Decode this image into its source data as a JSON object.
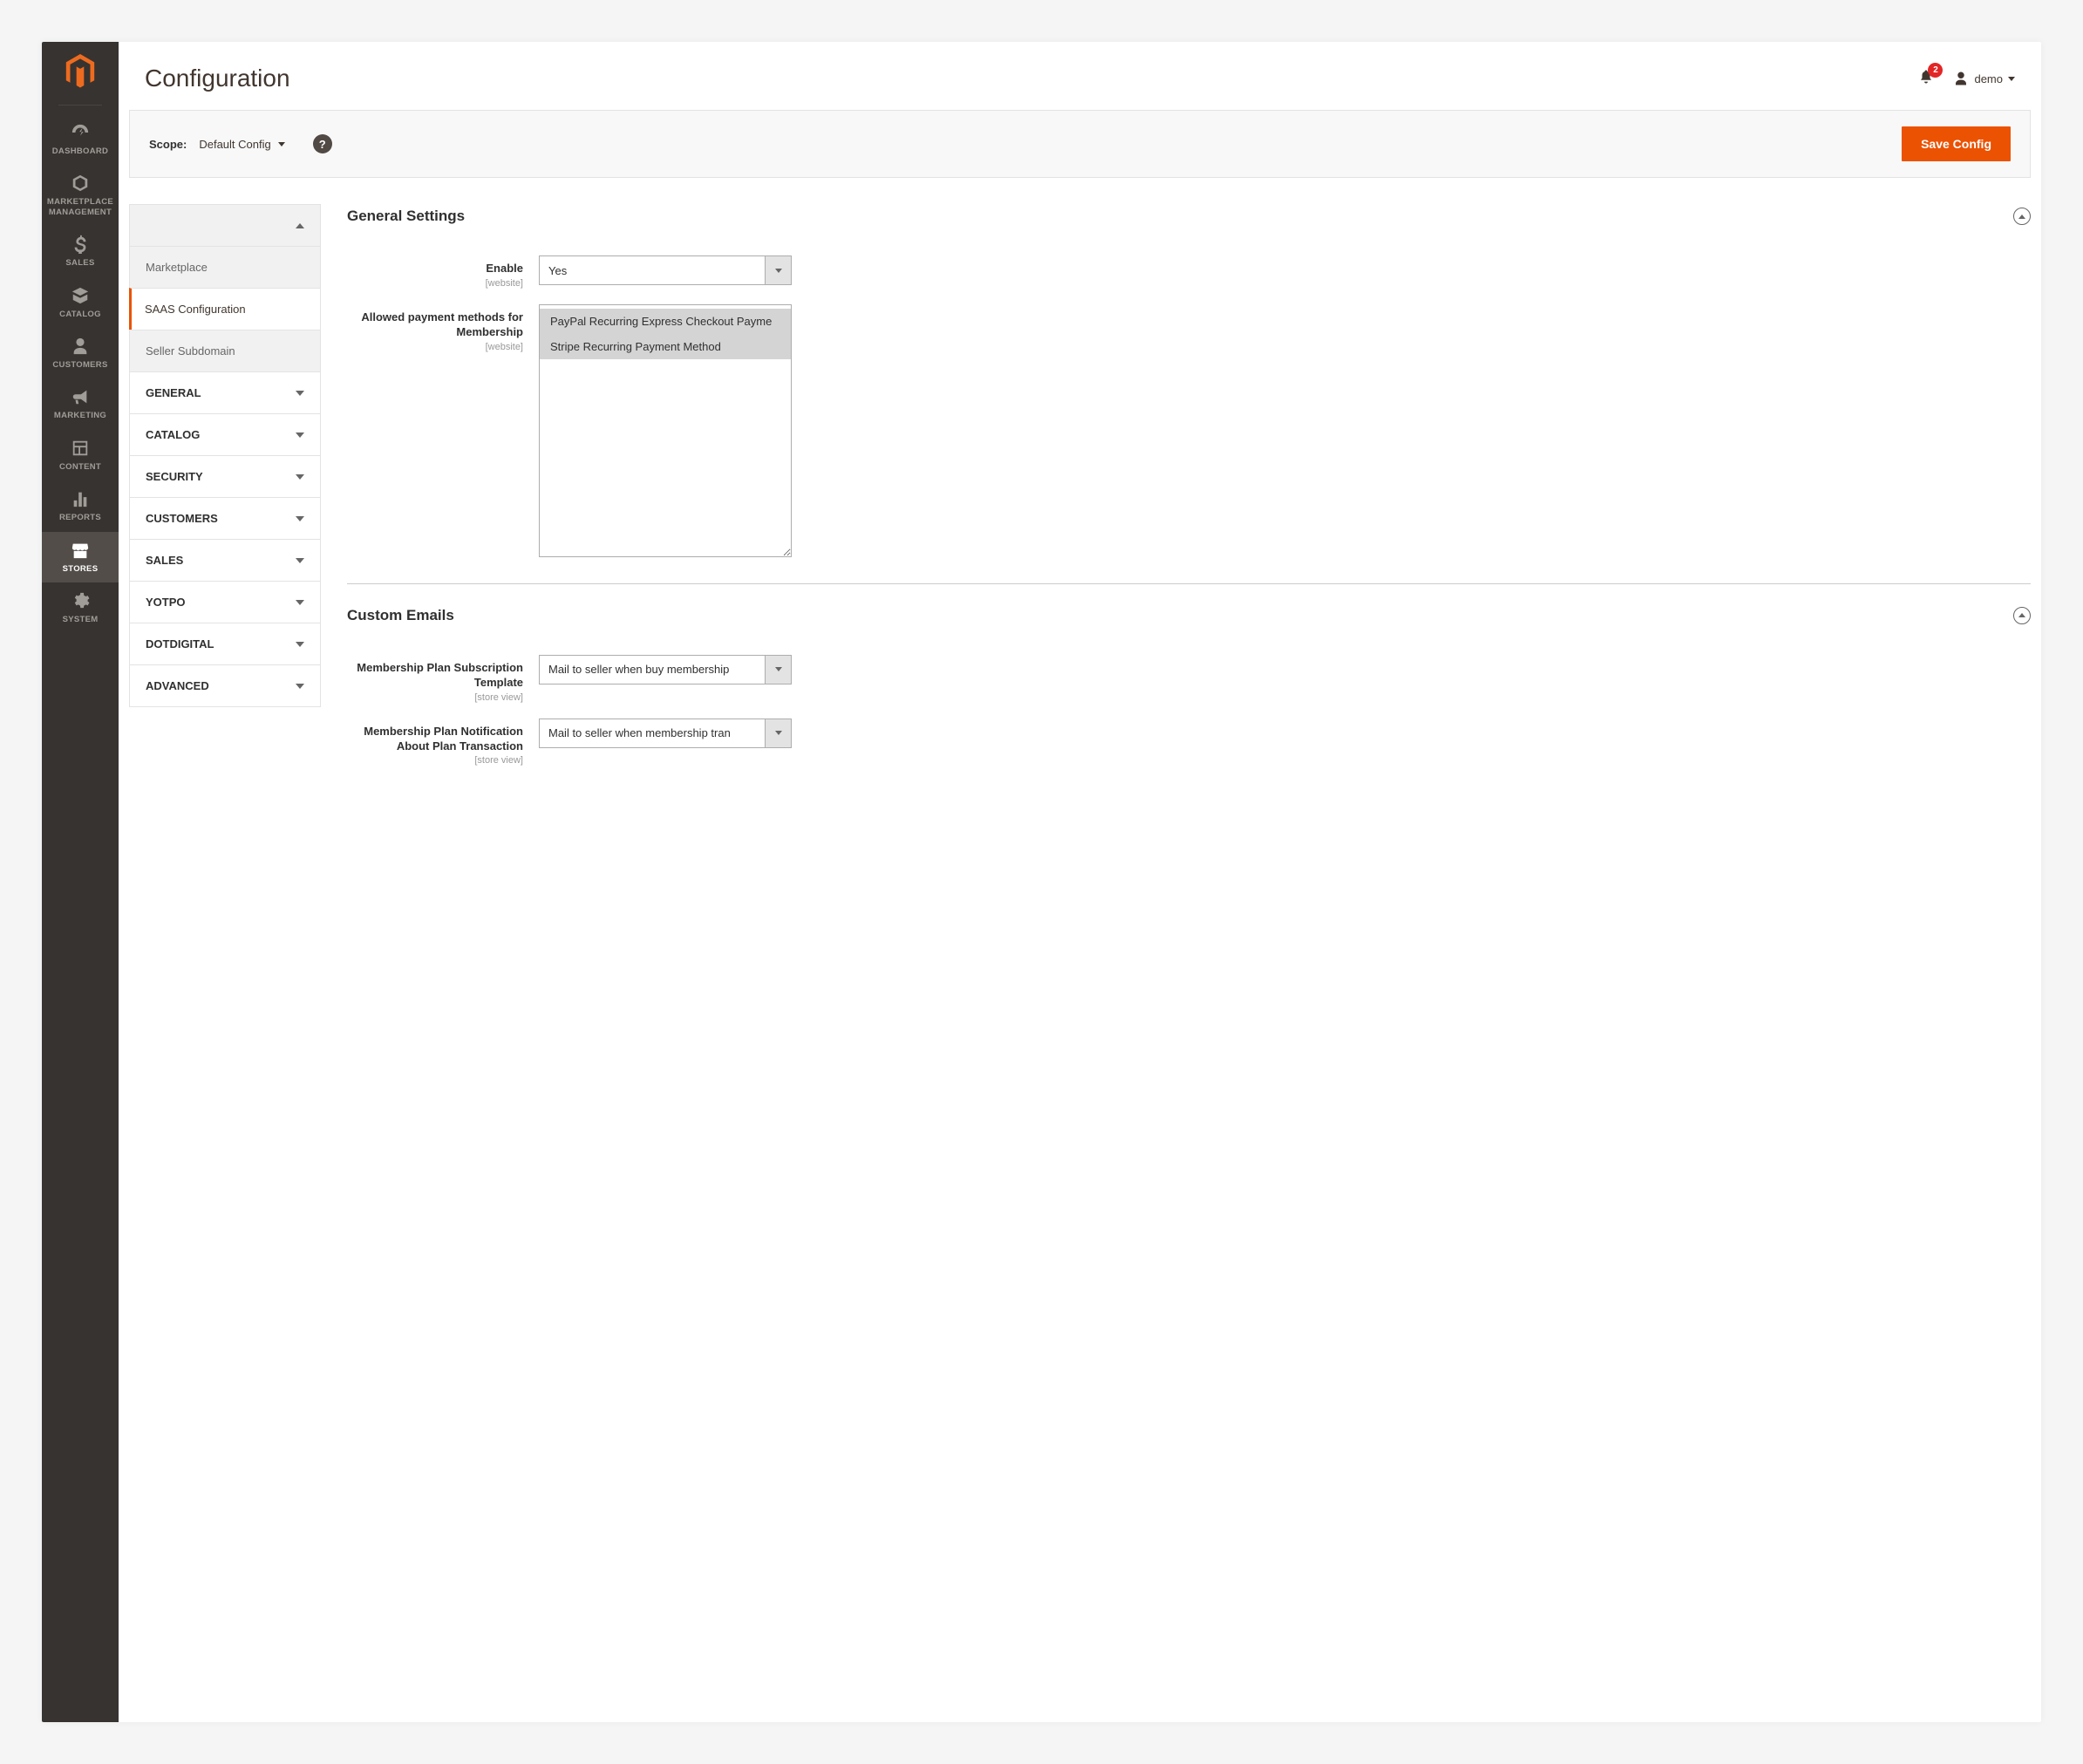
{
  "page_title": "Configuration",
  "notifications_count": "2",
  "user_name": "demo",
  "scope": {
    "label": "Scope:",
    "value": "Default Config"
  },
  "save_button": "Save Config",
  "sidebar_nav": [
    {
      "label": "DASHBOARD",
      "icon": "dashboard"
    },
    {
      "label": "MARKETPLACE MANAGEMENT",
      "icon": "marketplace"
    },
    {
      "label": "SALES",
      "icon": "sales"
    },
    {
      "label": "CATALOG",
      "icon": "catalog"
    },
    {
      "label": "CUSTOMERS",
      "icon": "customers"
    },
    {
      "label": "MARKETING",
      "icon": "marketing"
    },
    {
      "label": "CONTENT",
      "icon": "content"
    },
    {
      "label": "REPORTS",
      "icon": "reports"
    },
    {
      "label": "STORES",
      "icon": "stores"
    },
    {
      "label": "SYSTEM",
      "icon": "system"
    }
  ],
  "config_sidebar": {
    "sub_items": [
      {
        "label": "Marketplace",
        "active": false
      },
      {
        "label": "SAAS Configuration",
        "active": true
      },
      {
        "label": "Seller Subdomain",
        "active": false
      }
    ],
    "categories": [
      {
        "label": "GENERAL"
      },
      {
        "label": "CATALOG"
      },
      {
        "label": "SECURITY"
      },
      {
        "label": "CUSTOMERS"
      },
      {
        "label": "SALES"
      },
      {
        "label": "YOTPO"
      },
      {
        "label": "DOTDIGITAL"
      },
      {
        "label": "ADVANCED"
      }
    ]
  },
  "sections": {
    "general": {
      "title": "General Settings",
      "fields": {
        "enable": {
          "label": "Enable",
          "scope": "[website]",
          "value": "Yes"
        },
        "payment_methods": {
          "label": "Allowed payment methods for Membership",
          "scope": "[website]",
          "options": [
            "PayPal Recurring Express Checkout Payme",
            "Stripe Recurring Payment Method"
          ]
        }
      }
    },
    "custom_emails": {
      "title": "Custom Emails",
      "fields": {
        "subscription_template": {
          "label": "Membership Plan Subscription Template",
          "scope": "[store view]",
          "value": "Mail to seller when buy membership"
        },
        "notification_template": {
          "label": "Membership Plan Notification About Plan Transaction",
          "scope": "[store view]",
          "value": "Mail to seller when membership tran"
        }
      }
    }
  }
}
